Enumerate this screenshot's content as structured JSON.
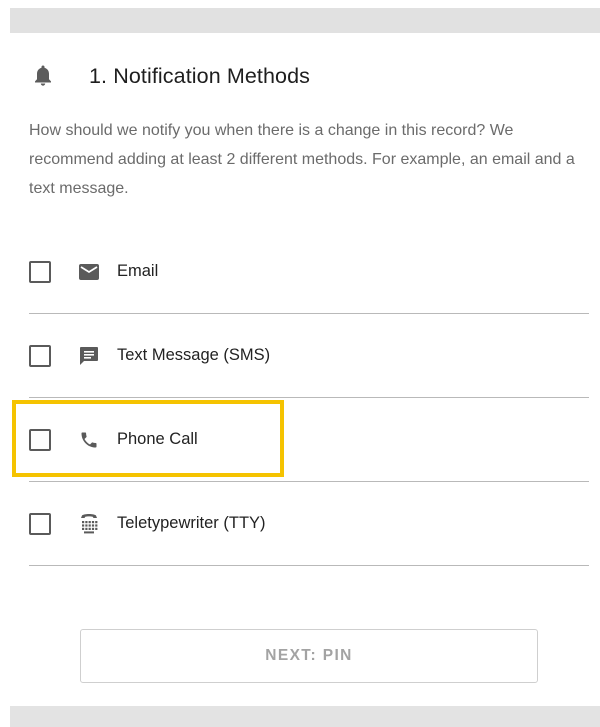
{
  "section": {
    "number_title": "1. Notification Methods",
    "description": "How should we notify you when there is a change in this record? We recommend adding at least 2 different methods. For example, an email and a text message.",
    "icon": "bell-icon"
  },
  "methods": [
    {
      "label": "Email",
      "icon": "email-icon",
      "checked": false
    },
    {
      "label": "Text Message (SMS)",
      "icon": "sms-icon",
      "checked": false
    },
    {
      "label": "Phone Call",
      "icon": "phone-icon",
      "checked": false,
      "highlighted": true
    },
    {
      "label": "Teletypewriter (TTY)",
      "icon": "tty-icon",
      "checked": false
    }
  ],
  "next_button": {
    "label": "NEXT: PIN",
    "enabled": false
  },
  "colors": {
    "highlight": "#f5c300",
    "icon": "#5a5a5a",
    "disabled_text": "#a3a3a3"
  }
}
